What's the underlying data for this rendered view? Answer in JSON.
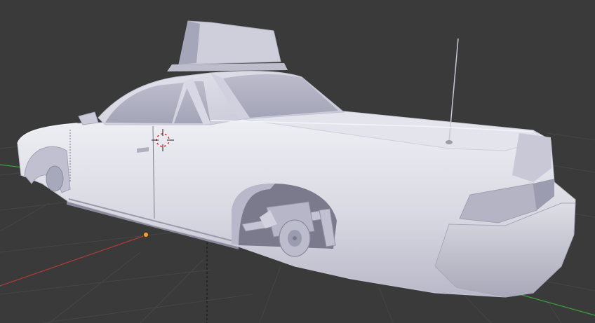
{
  "viewport": {
    "background": "#3a3a3a",
    "grid_color": "#4a4a4a",
    "x_axis_color": "#b03a3a",
    "y_axis_color": "#3aa03a"
  },
  "scene_object": {
    "type": "car-mesh",
    "shading": "solid",
    "base_color": "#dcdce6"
  },
  "cursor": {
    "icon": "3d-cursor-icon",
    "colors": [
      "#ffffff",
      "#d83030"
    ]
  },
  "origin": {
    "icon": "object-origin-icon",
    "color": "#f0a040"
  }
}
